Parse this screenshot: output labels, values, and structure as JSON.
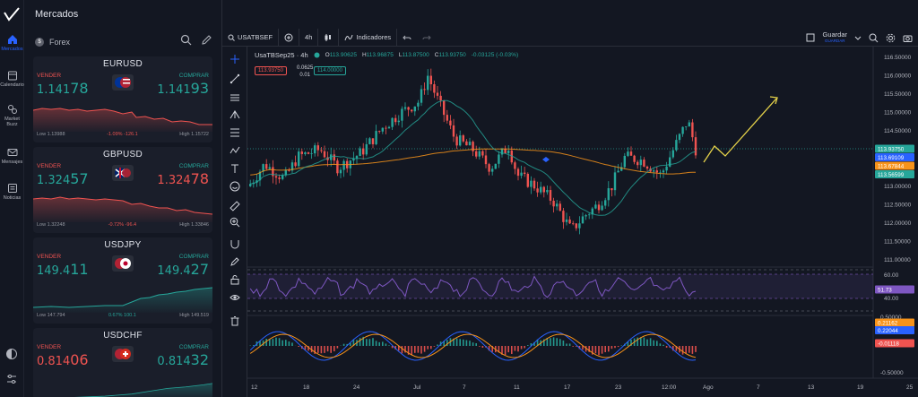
{
  "rail": {
    "items": [
      {
        "label": "Mercados",
        "active": true
      },
      {
        "label": "Calendario",
        "active": false
      },
      {
        "label": "Market Buzz",
        "active": false
      },
      {
        "label": "Mensajes",
        "active": false
      },
      {
        "label": "Noticias",
        "active": false
      }
    ]
  },
  "panel": {
    "title": "Mercados",
    "category": "Forex",
    "category_icon": "$",
    "cards": [
      {
        "symbol": "EURUSD",
        "sell_label": "VENDER",
        "buy_label": "COMPRAR",
        "sell_main": "1.141",
        "sell_big": "78",
        "buy_main": "1.141",
        "buy_big": "93",
        "low": "Low 1.13988",
        "change": "-1.09% -126.1",
        "high": "High 1.15722",
        "trend": "down"
      },
      {
        "symbol": "GBPUSD",
        "sell_label": "VENDER",
        "buy_label": "COMPRAR",
        "sell_main": "1.324",
        "sell_big": "57",
        "buy_main": "1.324",
        "buy_big": "78",
        "low": "Low 1.32248",
        "change": "-0.72% -96.4",
        "high": "High 1.33846",
        "trend": "down"
      },
      {
        "symbol": "USDJPY",
        "sell_label": "VENDER",
        "buy_label": "COMPRAR",
        "sell_main": "149.4",
        "sell_big": "11",
        "buy_main": "149.4",
        "buy_big": "27",
        "low": "Low 147.794",
        "change": "0.67% 100.1",
        "high": "High 149.519",
        "trend": "up"
      },
      {
        "symbol": "USDCHF",
        "sell_label": "VENDER",
        "buy_label": "COMPRAR",
        "sell_main": "0.814",
        "sell_big": "06",
        "buy_main": "0.814",
        "buy_big": "32",
        "low": "",
        "change": "",
        "high": "",
        "trend": "up"
      }
    ]
  },
  "toolbar": {
    "symbol": "USATBSEF",
    "interval": "4h",
    "indicators": "Indicadores",
    "save": "Guardar",
    "save_sub": "GUARDAR"
  },
  "legend": {
    "name": "UsaTBSep25 · 4h",
    "o_label": "O",
    "o": "113.90625",
    "h_label": "H",
    "h": "113.96875",
    "l_label": "L",
    "l": "113.87500",
    "c_label": "C",
    "c": "113.93750",
    "chg": "-0.03125 (-0.03%)",
    "sell_box": "113.93750",
    "spread_top": "0.0625",
    "spread_bot": "0.01",
    "buy_box": "114.00000"
  },
  "axis": {
    "price_ticks": [
      "116.50000",
      "116.00000",
      "115.50000",
      "115.00000",
      "114.50000",
      "114.00000",
      "113.50000",
      "113.00000",
      "112.50000",
      "112.00000",
      "111.50000",
      "111.00000"
    ],
    "price_tags": [
      {
        "value": "113.93750",
        "color": "#26a69a"
      },
      {
        "value": "113.69109",
        "color": "#2962ff"
      },
      {
        "value": "113.67844",
        "color": "#f7931a"
      },
      {
        "value": "113.56599",
        "color": "#26a69a"
      }
    ],
    "rsi_ticks": [
      "60.00",
      "40.00"
    ],
    "rsi_tag": "51.73",
    "macd_tags": [
      {
        "value": "0.21162",
        "color": "#f7931a"
      },
      {
        "value": "0.22044",
        "color": "#2962ff"
      },
      {
        "value": "-0.01118",
        "color": "#ef5350"
      }
    ],
    "macd_ticks": [
      "0.50000",
      "-0.50000"
    ],
    "time_ticks": [
      "12",
      "18",
      "24",
      "Jul",
      "7",
      "11",
      "17",
      "23",
      "12:00",
      "Ago",
      "7",
      "13",
      "19",
      "25"
    ]
  }
}
